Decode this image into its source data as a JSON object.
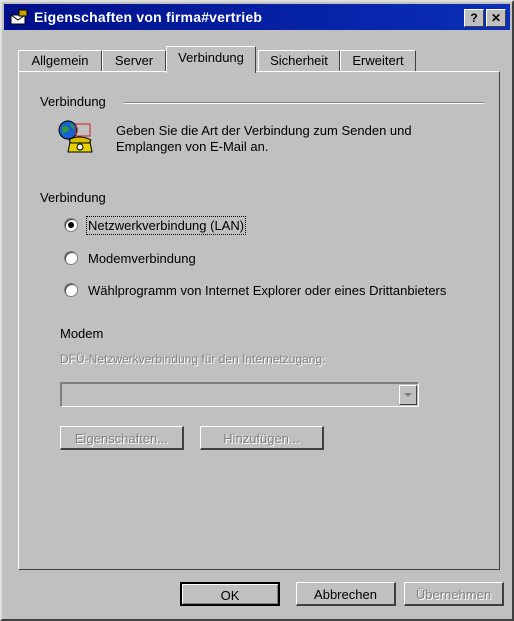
{
  "window": {
    "title": "Eigenschaften von firma#vertrieb",
    "help_label": "?",
    "close_label": "✕"
  },
  "tabs": [
    {
      "label": "Allgemein"
    },
    {
      "label": "Server"
    },
    {
      "label": "Verbindung"
    },
    {
      "label": "Sicherheit"
    },
    {
      "label": "Erweitert"
    }
  ],
  "active_tab": "Verbindung",
  "connection": {
    "group_label": "Verbindung",
    "description": "Geben Sie die Art der Verbindung zum Senden und Emplangen von E-Mail an.",
    "options_label": "Verbindung",
    "options": [
      {
        "label": "Netzwerkverbindung (LAN)",
        "checked": true
      },
      {
        "label": "Modemverbindung",
        "checked": false
      },
      {
        "label": "Wählprogramm von Internet Explorer oder eines Drittanbieters",
        "checked": false
      }
    ]
  },
  "modem": {
    "group_label": "Modem",
    "dialup_label": "DFÜ-Netzwerkverbindung für den Internetzugang:",
    "dialup_value": "",
    "properties_button": "Eigenschaften...",
    "add_button": "Hinzufügen..."
  },
  "footer": {
    "ok": "OK",
    "cancel": "Abbrechen",
    "apply": "Übernehmen"
  }
}
